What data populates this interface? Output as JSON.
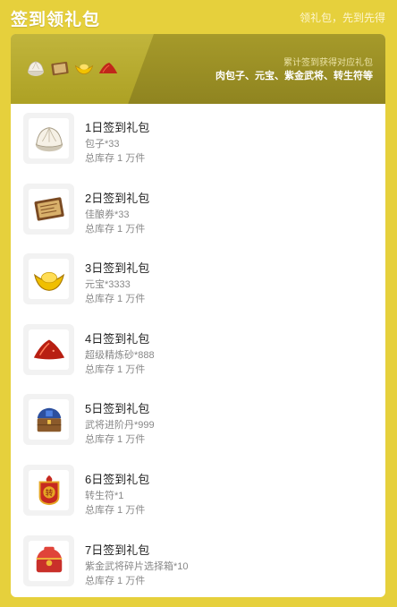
{
  "header": {
    "title": "签到领礼包",
    "slogan": "领礼包，先到先得"
  },
  "banner": {
    "icons": [
      "bun-icon",
      "ticket-icon",
      "gold-ingot-icon",
      "red-sand-icon"
    ],
    "subtitle": "累计签到获得对应礼包",
    "rewards": "肉包子、元宝、紫金武将、转生符等"
  },
  "gifts": [
    {
      "title": "1日签到礼包",
      "content": "包子*33",
      "stock": "总库存 1 万件",
      "icon": "bun-icon"
    },
    {
      "title": "2日签到礼包",
      "content": "佳酿券*33",
      "stock": "总库存 1 万件",
      "icon": "ticket-icon"
    },
    {
      "title": "3日签到礼包",
      "content": "元宝*3333",
      "stock": "总库存 1 万件",
      "icon": "gold-ingot-icon"
    },
    {
      "title": "4日签到礼包",
      "content": "超级精炼砂*888",
      "stock": "总库存 1 万件",
      "icon": "red-sand-icon"
    },
    {
      "title": "5日签到礼包",
      "content": "武将进阶丹*999",
      "stock": "总库存 1 万件",
      "icon": "treasure-chest-icon"
    },
    {
      "title": "6日签到礼包",
      "content": "转生符*1",
      "stock": "总库存 1 万件",
      "icon": "rebirth-talisman-icon"
    },
    {
      "title": "7日签到礼包",
      "content": "紫金武将碎片选择箱*10",
      "stock": "总库存 1 万件",
      "icon": "red-chest-icon"
    }
  ]
}
